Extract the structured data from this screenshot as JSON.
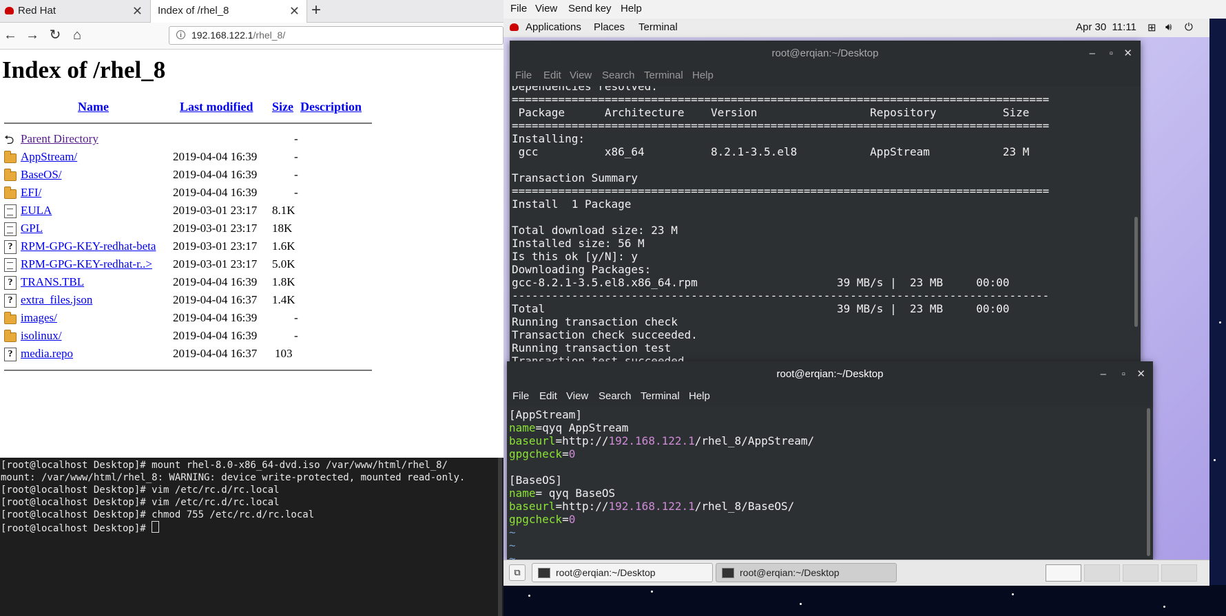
{
  "browser": {
    "tabs": [
      {
        "label": "Red Hat"
      },
      {
        "label": "Index of /rhel_8"
      }
    ],
    "new_tab": "+",
    "url": {
      "host": "192.168.122.1",
      "path": "/rhel_8/"
    },
    "page": {
      "title": "Index of /rhel_8",
      "columns": [
        "Name",
        "Last modified",
        "Size",
        "Description"
      ],
      "rows": [
        {
          "name": "Parent Directory",
          "modified": "",
          "size": "-",
          "icon": "back-icon"
        },
        {
          "name": "AppStream/",
          "modified": "2019-04-04 16:39",
          "size": "-",
          "icon": "folder-icon"
        },
        {
          "name": "BaseOS/",
          "modified": "2019-04-04 16:39",
          "size": "-",
          "icon": "folder-icon"
        },
        {
          "name": "EFI/",
          "modified": "2019-04-04 16:39",
          "size": "-",
          "icon": "folder-icon"
        },
        {
          "name": "EULA",
          "modified": "2019-03-01 23:17",
          "size": "8.1K",
          "icon": "text-file-icon"
        },
        {
          "name": "GPL",
          "modified": "2019-03-01 23:17",
          "size": "18K",
          "icon": "text-file-icon"
        },
        {
          "name": "RPM-GPG-KEY-redhat-beta",
          "modified": "2019-03-01 23:17",
          "size": "1.6K",
          "icon": "unknown-file-icon"
        },
        {
          "name": "RPM-GPG-KEY-redhat-r..>",
          "modified": "2019-03-01 23:17",
          "size": "5.0K",
          "icon": "text-file-icon"
        },
        {
          "name": "TRANS.TBL",
          "modified": "2019-04-04 16:39",
          "size": "1.8K",
          "icon": "unknown-file-icon"
        },
        {
          "name": "extra_files.json",
          "modified": "2019-04-04 16:37",
          "size": "1.4K",
          "icon": "unknown-file-icon"
        },
        {
          "name": "images/",
          "modified": "2019-04-04 16:39",
          "size": "-",
          "icon": "folder-icon"
        },
        {
          "name": "isolinux/",
          "modified": "2019-04-04 16:39",
          "size": "-",
          "icon": "folder-icon"
        },
        {
          "name": "media.repo",
          "modified": "2019-04-04 16:37",
          "size": "103",
          "icon": "unknown-file-icon"
        }
      ]
    }
  },
  "host_terminal": {
    "lines": [
      "[root@localhost Desktop]# mount rhel-8.0-x86_64-dvd.iso /var/www/html/rhel_8/",
      "mount: /var/www/html/rhel_8: WARNING: device write-protected, mounted read-only.",
      "[root@localhost Desktop]# vim /etc/rc.d/rc.local",
      "[root@localhost Desktop]# vim /etc/rc.d/rc.local",
      "[root@localhost Desktop]# chmod 755 /etc/rc.d/rc.local",
      "[root@localhost Desktop]# "
    ]
  },
  "vm": {
    "menu": [
      "File",
      "View",
      "Send key",
      "Help"
    ],
    "topbar": {
      "applications": "Applications",
      "places": "Places",
      "terminal": "Terminal",
      "clock": "Apr 30  11:11"
    },
    "terminal_a": {
      "title": "root@erqian:~/Desktop",
      "menu": [
        "File",
        "Edit",
        "View",
        "Search",
        "Terminal",
        "Help"
      ],
      "lines": [
        "Dependencies resolved.",
        "=================================================================================",
        " Package      Architecture    Version                 Repository          Size",
        "=================================================================================",
        "Installing:",
        " gcc          x86_64          8.2.1-3.5.el8           AppStream           23 M",
        "",
        "Transaction Summary",
        "=================================================================================",
        "Install  1 Package",
        "",
        "Total download size: 23 M",
        "Installed size: 56 M",
        "Is this ok [y/N]: y",
        "Downloading Packages:",
        "gcc-8.2.1-3.5.el8.x86_64.rpm                     39 MB/s |  23 MB     00:00",
        "---------------------------------------------------------------------------------",
        "Total                                            39 MB/s |  23 MB     00:00",
        "Running transaction check",
        "Transaction check succeeded.",
        "Running transaction test",
        "Transaction test succeeded."
      ]
    },
    "terminal_b": {
      "title": "root@erqian:~/Desktop",
      "menu": [
        "File",
        "Edit",
        "View",
        "Search",
        "Terminal",
        "Help"
      ],
      "repo1": {
        "section": "[AppStream]",
        "name_key": "name",
        "name_val": "qyq AppStream",
        "baseurl_key": "baseurl",
        "baseurl_pre": "http://",
        "ip": "192.168.122.1",
        "baseurl_path": "/rhel_8/AppStream/",
        "gpg_key": "gpgcheck",
        "gpg_val": "0"
      },
      "repo2": {
        "section": "[BaseOS]",
        "name_key": "name",
        "name_val": " qyq BaseOS",
        "baseurl_key": "baseurl",
        "baseurl_pre": "http://",
        "ip": "192.168.122.1",
        "baseurl_path": "/rhel_8/BaseOS/",
        "gpg_key": "gpgcheck",
        "gpg_val": "0"
      },
      "tildes": [
        "~",
        "~",
        "~"
      ]
    },
    "taskbar": {
      "items": [
        "root@erqian:~/Desktop",
        "root@erqian:~/Desktop"
      ]
    }
  }
}
